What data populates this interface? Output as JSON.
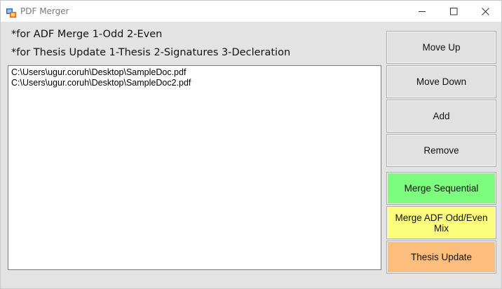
{
  "window": {
    "title": "PDF Merger"
  },
  "hints": {
    "line1": "*for ADF Merge 1-Odd 2-Even",
    "line2": "*for Thesis Update 1-Thesis 2-Signatures 3-Decleration"
  },
  "files": [
    "C:\\Users\\ugur.coruh\\Desktop\\SampleDoc.pdf",
    "C:\\Users\\ugur.coruh\\Desktop\\SampleDoc2.pdf"
  ],
  "buttons": {
    "move_up": "Move Up",
    "move_down": "Move Down",
    "add": "Add",
    "remove": "Remove",
    "merge_sequential": "Merge Sequential",
    "merge_adf": "Merge ADF Odd/Even Mix",
    "thesis_update": "Thesis Update"
  },
  "colors": {
    "merge_sequential": "#7dfd7d",
    "merge_adf": "#fdfd7d",
    "thesis_update": "#fdbe7d"
  },
  "icons": {
    "app": "pdf-merger-app-icon",
    "minimize": "minimize-icon",
    "maximize": "maximize-icon",
    "close": "close-icon"
  }
}
